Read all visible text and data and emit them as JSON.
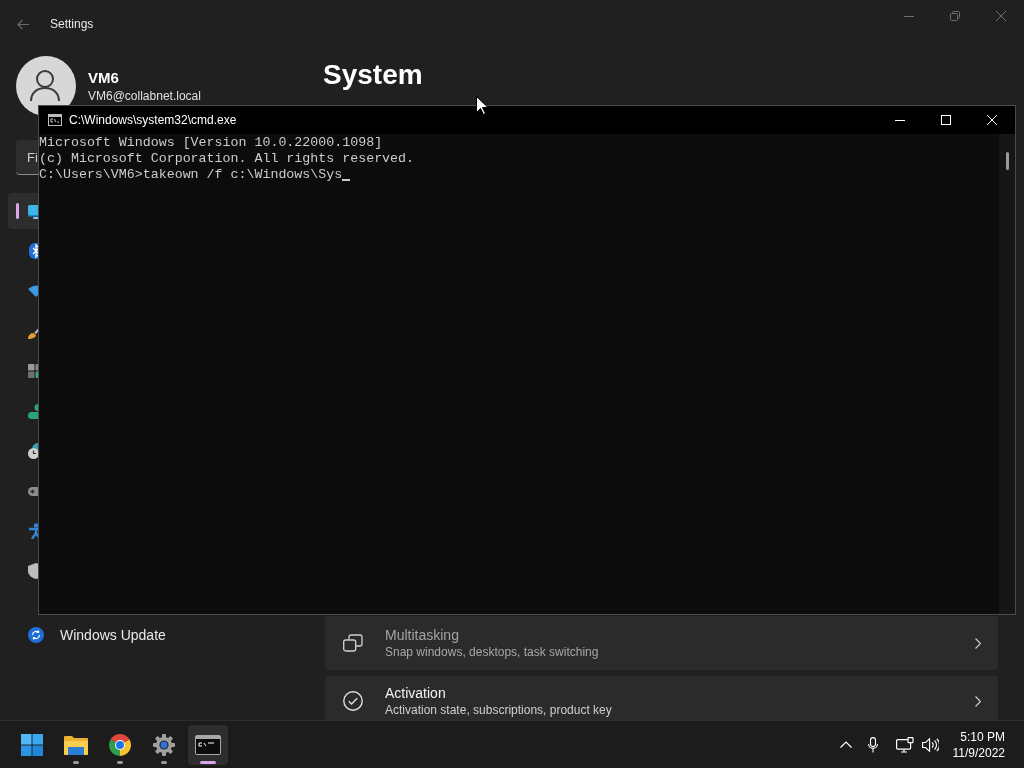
{
  "settings_window": {
    "title": "Settings",
    "user": {
      "name": "VM6",
      "email": "VM6@collabnet.local"
    },
    "search": {
      "placeholder": "Fi"
    },
    "nav_items": [
      {
        "kind": "display",
        "selected": true
      },
      {
        "kind": "bluetooth",
        "selected": false
      },
      {
        "kind": "wifi",
        "selected": false
      },
      {
        "kind": "brush",
        "selected": false
      },
      {
        "kind": "apps",
        "selected": false
      },
      {
        "kind": "people",
        "selected": false
      },
      {
        "kind": "clock",
        "selected": false
      },
      {
        "kind": "gamepad",
        "selected": false
      },
      {
        "kind": "accessibility",
        "selected": false
      },
      {
        "kind": "shield",
        "selected": false
      },
      {
        "kind": "update",
        "label": "Windows Update",
        "selected": false
      }
    ],
    "page_title": "System",
    "cards": [
      {
        "kind": "multitasking",
        "title": "Multitasking",
        "subtitle": "Snap windows, desktops, task switching",
        "dimmed": true
      },
      {
        "kind": "activation",
        "title": "Activation",
        "subtitle": "Activation state, subscriptions, product key",
        "dimmed": false
      }
    ]
  },
  "console_window": {
    "title": "C:\\Windows\\system32\\cmd.exe",
    "lines": [
      "Microsoft Windows [Version 10.0.22000.1098]",
      "(c) Microsoft Corporation. All rights reserved.",
      "C:\\Users\\VM6>takeown /f c:\\Windows\\Sys"
    ]
  },
  "taskbar": {
    "apps": [
      {
        "kind": "start",
        "running": false,
        "selected": false
      },
      {
        "kind": "folder",
        "running": true,
        "selected": false
      },
      {
        "kind": "browser",
        "running": true,
        "selected": false
      },
      {
        "kind": "settings",
        "running": true,
        "selected": false
      },
      {
        "kind": "terminal",
        "running": true,
        "selected": true
      }
    ],
    "clock": {
      "time": "5:10 PM",
      "date": "11/9/2022"
    }
  }
}
